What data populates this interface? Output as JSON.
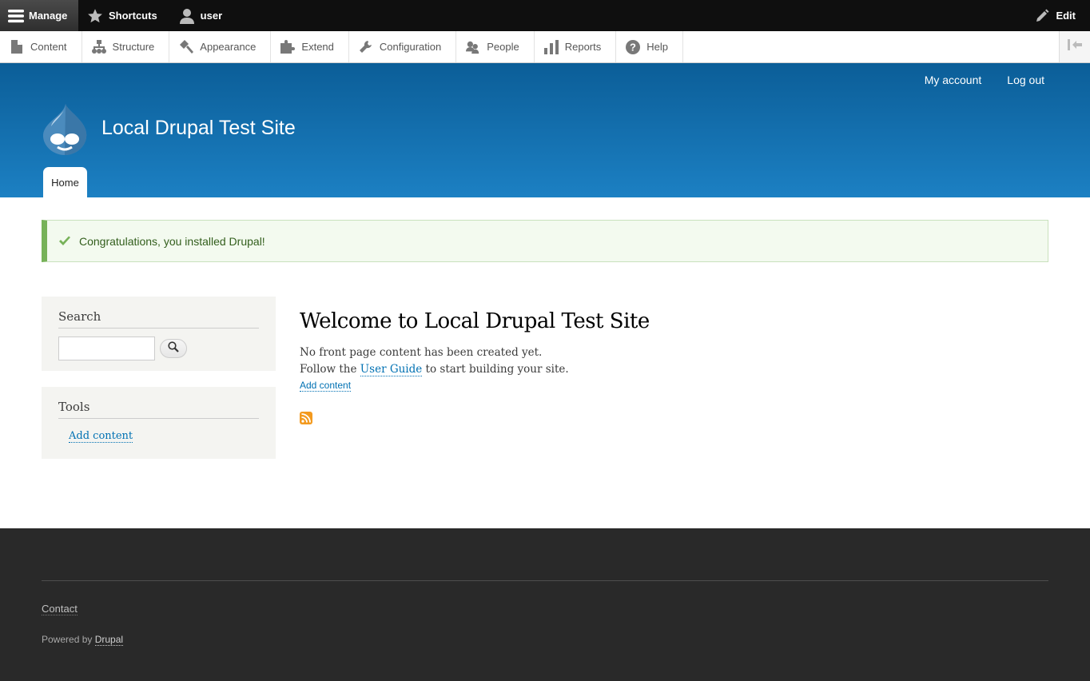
{
  "toolbar": {
    "manage": "Manage",
    "shortcuts": "Shortcuts",
    "user": "user",
    "edit": "Edit"
  },
  "tray": {
    "items": [
      {
        "label": "Content",
        "icon": "file-icon"
      },
      {
        "label": "Structure",
        "icon": "sitemap-icon"
      },
      {
        "label": "Appearance",
        "icon": "brush-icon"
      },
      {
        "label": "Extend",
        "icon": "puzzle-icon"
      },
      {
        "label": "Configuration",
        "icon": "wrench-icon"
      },
      {
        "label": "People",
        "icon": "people-icon"
      },
      {
        "label": "Reports",
        "icon": "bar-chart-icon"
      },
      {
        "label": "Help",
        "icon": "help-icon"
      }
    ]
  },
  "header": {
    "my_account": "My account",
    "log_out": "Log out",
    "site_name": "Local Drupal Test Site",
    "tab_home": "Home"
  },
  "message": {
    "text": "Congratulations, you installed Drupal!",
    "status_color": "#77b259"
  },
  "sidebar": {
    "search_title": "Search",
    "search_value": "",
    "tools_title": "Tools",
    "tools_link": "Add content"
  },
  "main": {
    "title": "Welcome to Local Drupal Test Site",
    "line1": "No front page content has been created yet.",
    "line2_pre": "Follow the ",
    "line2_link": "User Guide",
    "line2_post": " to start building your site.",
    "add_content": "Add content"
  },
  "footer": {
    "contact": "Contact",
    "powered_pre": "Powered by ",
    "powered_link": "Drupal"
  },
  "colors": {
    "header_top": "#0b5e98",
    "header_bottom": "#1c80c3",
    "link": "#0071b3",
    "footer_bg": "#292929"
  }
}
